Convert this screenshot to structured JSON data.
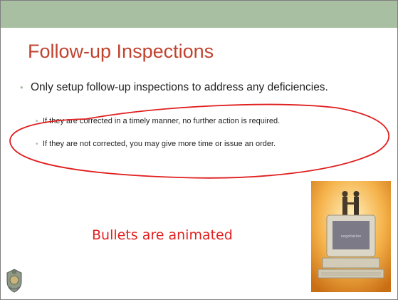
{
  "slide": {
    "title": "Follow-up Inspections",
    "bullets": [
      {
        "text": "Only setup follow-up inspections to address any deficiencies.",
        "sub": [
          "If they are corrected in a timely manner, no further action is required.",
          "If they are not corrected, you may give more time or issue an order."
        ]
      }
    ],
    "note": "Bullets are animated",
    "photo_screen_text": "negotiation"
  },
  "colors": {
    "top_band": "#a9bfa2",
    "title": "#c1432f",
    "annotation": "#e02020",
    "bullet_marker": "#a9bfa2"
  },
  "icons": [
    "crest-logo-icon",
    "negotiation-computer-image"
  ]
}
